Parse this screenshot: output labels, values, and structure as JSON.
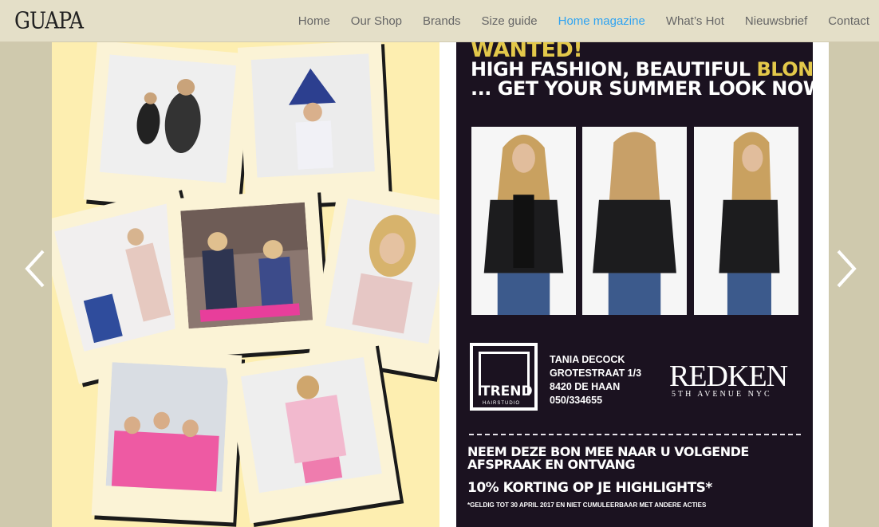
{
  "header": {
    "logo": "GUAPA",
    "nav": [
      {
        "label": "Home"
      },
      {
        "label": "Our Shop"
      },
      {
        "label": "Brands"
      },
      {
        "label": "Size guide"
      },
      {
        "label": "Home magazine",
        "active": true
      },
      {
        "label": "What’s Hot"
      },
      {
        "label": "Nieuwsbrief"
      },
      {
        "label": "Contact"
      }
    ]
  },
  "slider": {
    "prev_icon": "chevron-left-icon",
    "next_icon": "chevron-right-icon"
  },
  "ad": {
    "wanted": "WANTED!",
    "title_line1_a": "HIGH FASHION, BEAUTIFUL ",
    "title_line1_b": "BLONDE",
    "title_line2": "... GET YOUR SUMMER LOOK NOW",
    "salon_logo_main": "TREND",
    "salon_logo_sub": "HAIRSTUDIO",
    "address": [
      "TANIA DECOCK",
      "GROTESTRAAT 1/3",
      "8420 DE HAAN",
      "050/334655"
    ],
    "brand": "REDKEN",
    "brand_sub": "5TH AVENUE NYC",
    "voucher_line1": "NEEM DEZE BON MEE NAAR U VOLGENDE",
    "voucher_line2": "AFSPRAAK EN ONTVANG",
    "discount": "10% KORTING OP JE HIGHLIGHTS*",
    "fineprint": "*GELDIG TOT 30 APRIL 2017 EN NIET CUMULEERBAAR MET ANDERE ACTIES"
  },
  "colors": {
    "accent_nav": "#2ea3f2",
    "ad_background": "#1b1220",
    "ad_yellow": "#e3c84a",
    "page_cream": "#fdeeb0"
  }
}
